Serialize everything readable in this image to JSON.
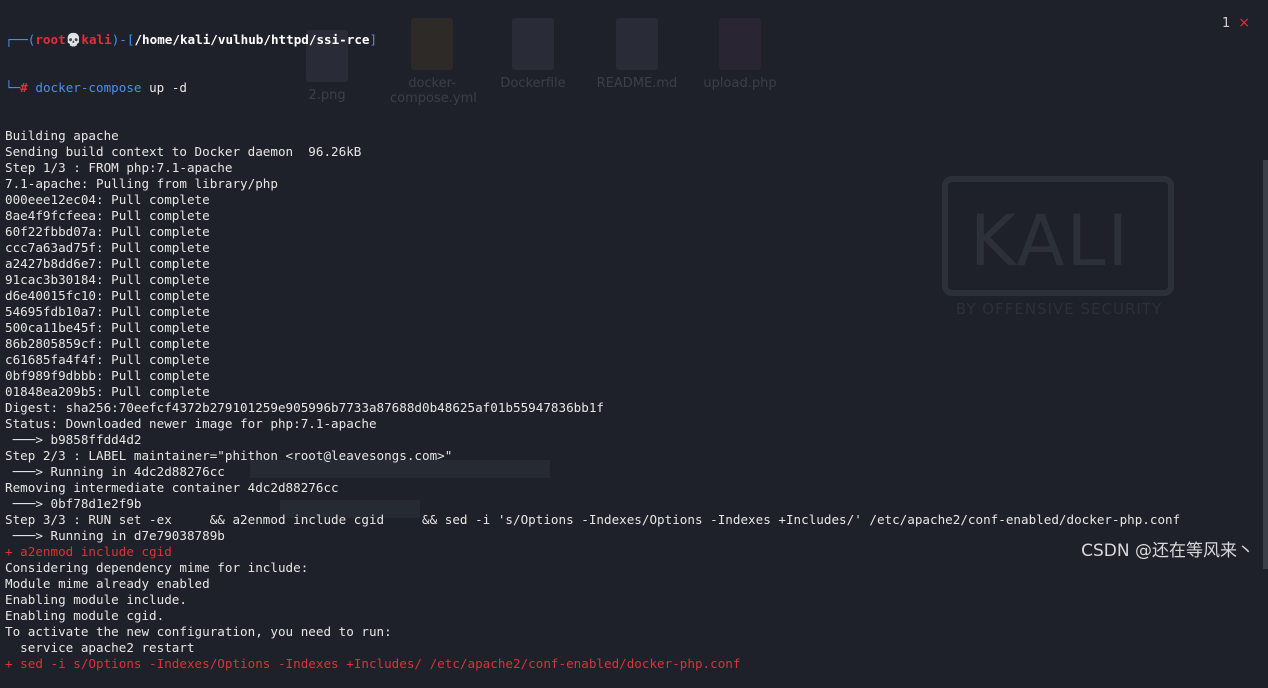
{
  "desktop_icons": [
    {
      "label": "2.png"
    },
    {
      "label": "docker-compose.yml"
    },
    {
      "label": "Dockerfile"
    },
    {
      "label": "README.md"
    },
    {
      "label": "upload.php"
    }
  ],
  "background_logo": {
    "word": "KALI",
    "sub": "BY OFFENSIVE SECURITY"
  },
  "tab": {
    "number": "1",
    "close": "×"
  },
  "prompt": {
    "bracket_open": "┌──(",
    "user": "root",
    "skull": "💀",
    "host": "kali",
    "bracket_mid": ")-[",
    "path": "/home/kali/vulhub/httpd/ssi-rce",
    "bracket_close": "]",
    "second_line": "└─",
    "hash": "#",
    "command": "docker-compose",
    "args": " up -d"
  },
  "lines": [
    "Building apache",
    "Sending build context to Docker daemon  96.26kB",
    "Step 1/3 : FROM php:7.1-apache",
    "7.1-apache: Pulling from library/php",
    "000eee12ec04: Pull complete",
    "8ae4f9fcfeea: Pull complete",
    "60f22fbbd07a: Pull complete",
    "ccc7a63ad75f: Pull complete",
    "a2427b8dd6e7: Pull complete",
    "91cac3b30184: Pull complete",
    "d6e40015fc10: Pull complete",
    "54695fdb10a7: Pull complete",
    "500ca11be45f: Pull complete",
    "86b2805859cf: Pull complete",
    "c61685fa4f4f: Pull complete",
    "0bf989f9dbbb: Pull complete",
    "01848ea209b5: Pull complete",
    "Digest: sha256:70eefcf4372b279101259e905996b7733a87688d0b48625af01b55947836bb1f",
    "Status: Downloaded newer image for php:7.1-apache",
    " ───> b9858ffdd4d2",
    "Step 2/3 : LABEL maintainer=\"phithon <root@leavesongs.com>\"",
    " ───> Running in 4dc2d88276cc",
    "Removing intermediate container 4dc2d88276cc",
    " ───> 0bf78d1e2f9b",
    "Step 3/3 : RUN set -ex     && a2enmod include cgid     && sed -i 's/Options -Indexes/Options -Indexes +Includes/' /etc/apache2/conf-enabled/docker-php.conf",
    " ───> Running in d7e79038789b",
    "+ a2enmod include cgid",
    "Considering dependency mime for include:",
    "Module mime already enabled",
    "Enabling module include.",
    "Enabling module cgid.",
    "To activate the new configuration, you need to run:",
    "  service apache2 restart",
    "+ sed -i s/Options -Indexes/Options -Indexes +Includes/ /etc/apache2/conf-enabled/docker-php.conf"
  ],
  "red_line_indices": [
    26,
    33
  ],
  "watermark": "CSDN @还在等风来丶",
  "colors": {
    "background": "#1e2129",
    "accent_red": "#e0303a",
    "path_blue": "#4d8fe8"
  }
}
